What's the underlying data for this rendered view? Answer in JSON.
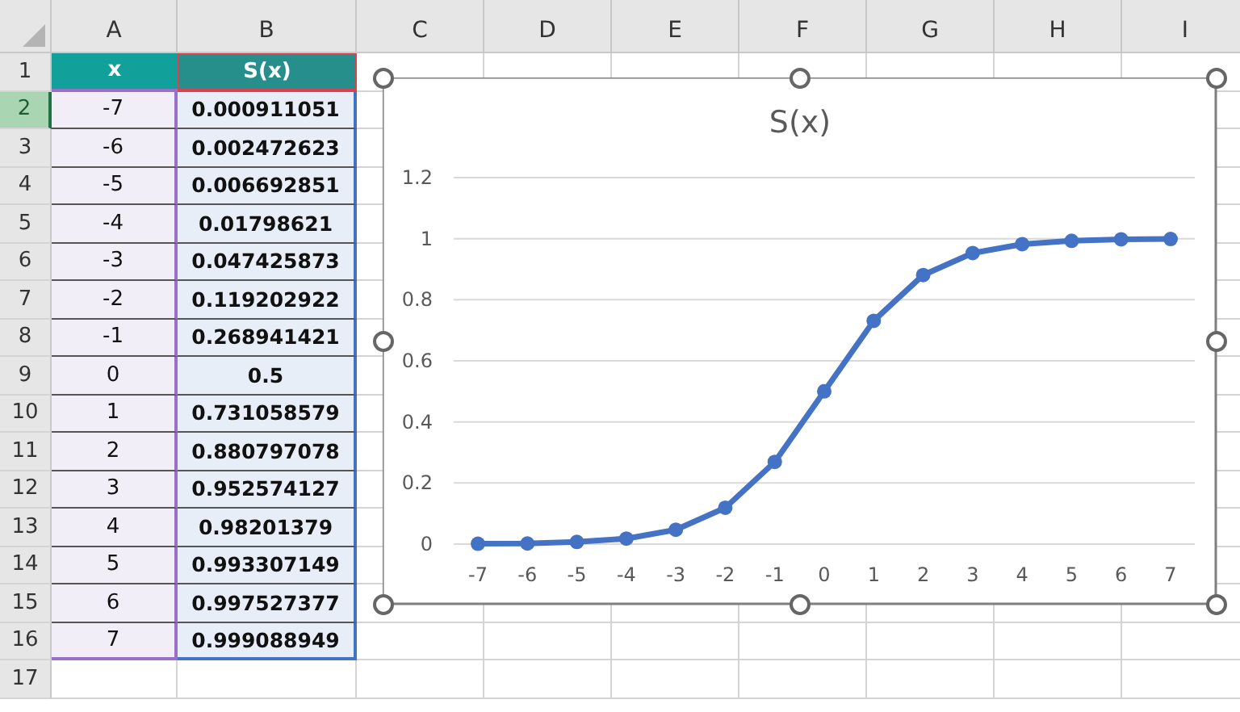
{
  "columns": [
    "A",
    "B",
    "C",
    "D",
    "E",
    "F",
    "G",
    "H",
    "I"
  ],
  "rows": [
    {
      "header": "1",
      "selected": false,
      "kind": "title",
      "cells": [
        "x",
        "S(x)"
      ]
    },
    {
      "header": "2",
      "selected": true,
      "kind": "data",
      "cells": [
        "-7",
        "0.000911051"
      ]
    },
    {
      "header": "3",
      "selected": false,
      "kind": "data",
      "cells": [
        "-6",
        "0.002472623"
      ]
    },
    {
      "header": "4",
      "selected": false,
      "kind": "data",
      "cells": [
        "-5",
        "0.006692851"
      ]
    },
    {
      "header": "5",
      "selected": false,
      "kind": "data",
      "cells": [
        "-4",
        "0.01798621"
      ]
    },
    {
      "header": "6",
      "selected": false,
      "kind": "data",
      "cells": [
        "-3",
        "0.047425873"
      ]
    },
    {
      "header": "7",
      "selected": false,
      "kind": "data",
      "cells": [
        "-2",
        "0.119202922"
      ]
    },
    {
      "header": "8",
      "selected": false,
      "kind": "data",
      "cells": [
        "-1",
        "0.268941421"
      ]
    },
    {
      "header": "9",
      "selected": false,
      "kind": "data",
      "cells": [
        "0",
        "0.5"
      ]
    },
    {
      "header": "10",
      "selected": false,
      "kind": "data",
      "cells": [
        "1",
        "0.731058579"
      ]
    },
    {
      "header": "11",
      "selected": false,
      "kind": "data",
      "cells": [
        "2",
        "0.880797078"
      ]
    },
    {
      "header": "12",
      "selected": false,
      "kind": "data",
      "cells": [
        "3",
        "0.952574127"
      ]
    },
    {
      "header": "13",
      "selected": false,
      "kind": "data",
      "cells": [
        "4",
        "0.98201379"
      ]
    },
    {
      "header": "14",
      "selected": false,
      "kind": "data",
      "cells": [
        "5",
        "0.993307149"
      ]
    },
    {
      "header": "15",
      "selected": false,
      "kind": "data",
      "cells": [
        "6",
        "0.997527377"
      ]
    },
    {
      "header": "16",
      "selected": false,
      "kind": "data",
      "cells": [
        "7",
        "0.999088949"
      ]
    },
    {
      "header": "17",
      "selected": false,
      "kind": "blank"
    }
  ],
  "chart": {
    "chart_data": {
      "type": "line",
      "title": "S(x)",
      "categories": [
        "-7",
        "-6",
        "-5",
        "-4",
        "-3",
        "-2",
        "-1",
        "0",
        "1",
        "2",
        "3",
        "4",
        "5",
        "6",
        "7"
      ],
      "series": [
        {
          "color": "#4472c4",
          "marker": true,
          "values": [
            0.001,
            0.002,
            0.007,
            0.018,
            0.047,
            0.119,
            0.269,
            0.5,
            0.731,
            0.881,
            0.953,
            0.982,
            0.993,
            0.998,
            0.999
          ]
        }
      ],
      "grid": true,
      "ylim": [
        0,
        1.2
      ],
      "yticks": [
        0,
        0.2,
        0.4,
        0.6,
        0.8,
        1,
        1.2
      ]
    }
  }
}
